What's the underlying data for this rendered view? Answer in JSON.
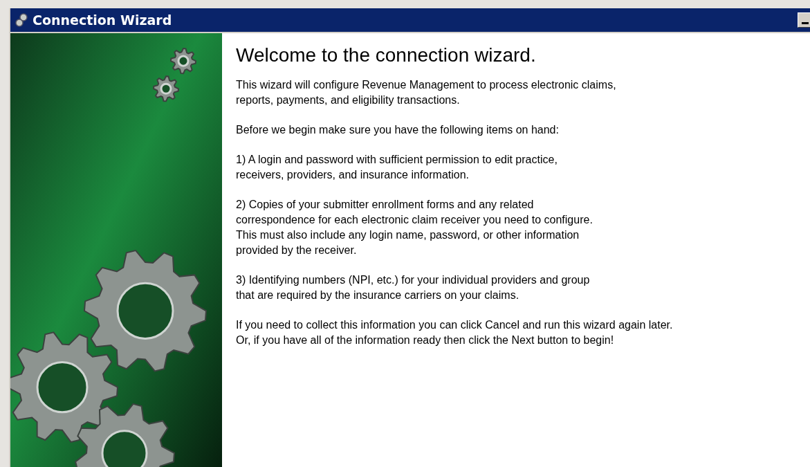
{
  "window": {
    "title": "Connection Wizard"
  },
  "heading": "Welcome to the connection wizard.",
  "paragraphs": [
    {
      "lines": [
        "This wizard will configure Revenue Management to process electronic claims,",
        "reports, payments, and eligibility transactions."
      ]
    },
    {
      "lines": [
        "Before we begin make sure you have the following items on hand:"
      ]
    },
    {
      "lines": [
        "1) A login and password with sufficient permission to edit practice,",
        "receivers, providers, and insurance information."
      ]
    },
    {
      "lines": [
        "2) Copies of your submitter enrollment forms and any related",
        "correspondence for each electronic claim receiver you need to configure.",
        "This must also include any login name, password, or other information",
        "provided by the receiver."
      ]
    },
    {
      "lines": [
        "3) Identifying numbers (NPI, etc.) for your individual providers and group",
        "that are required by the insurance carriers on your claims."
      ]
    },
    {
      "lines": [
        "If you need to collect this information you can click Cancel and run this wizard again later.",
        "Or, if you have all of the information ready then click the Next button to begin!"
      ]
    }
  ]
}
